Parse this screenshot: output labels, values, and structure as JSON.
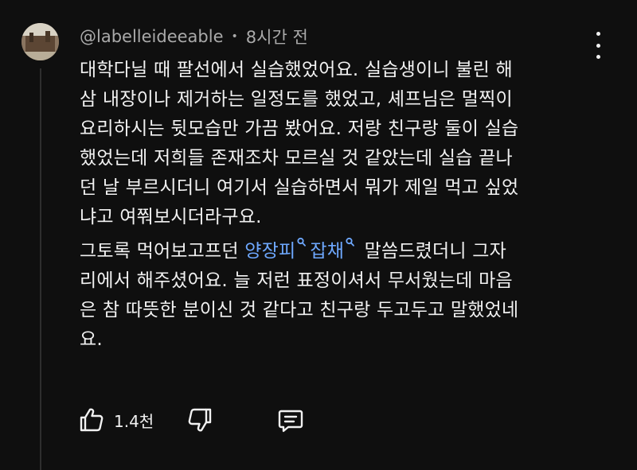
{
  "comment": {
    "author": "@labelleideeable",
    "separator": "•",
    "time": "8시간 전",
    "lines_para1": [
      "대학다닐 때 팔선에서 실습했었어요. 실습생이니 불린 해",
      "삼 내장이나 제거하는  일정도를 했었고, 셰프님은 멀찍이",
      "요리하시는 뒷모습만 가끔 봤어요. 저랑 친구랑 둘이 실습",
      "했었는데 저희들 존재조차 모르실 것 같았는데 실습 끝나",
      "던 날 부르시더니 여기서 실습하면서 뭐가 제일 먹고 싶었",
      "냐고 여쭤보시더라구요."
    ],
    "para2_line1_before": "그토록 먹어보고프던 ",
    "link_1": "양장피",
    "link_2": "잡채",
    "para2_line1_after": " 말씀드렸더니 그자",
    "lines_para2_rest": [
      "리에서 해주셨어요. 늘 저런 표정이셔서 무서웠는데 마음",
      "은 참 따뜻한 분이신 것 같다고 친구랑  두고두고 말했었네",
      "요."
    ],
    "like_count": "1.4천"
  },
  "icons": {
    "more": "more-vert-icon",
    "like": "thumbs-up-icon",
    "dislike": "thumbs-down-icon",
    "reply": "reply-comment-icon",
    "search": "search-icon"
  },
  "colors": {
    "background": "#0f0f0f",
    "text": "#f1f1f1",
    "meta": "#aaaaaa",
    "link": "#6ea8ff"
  }
}
